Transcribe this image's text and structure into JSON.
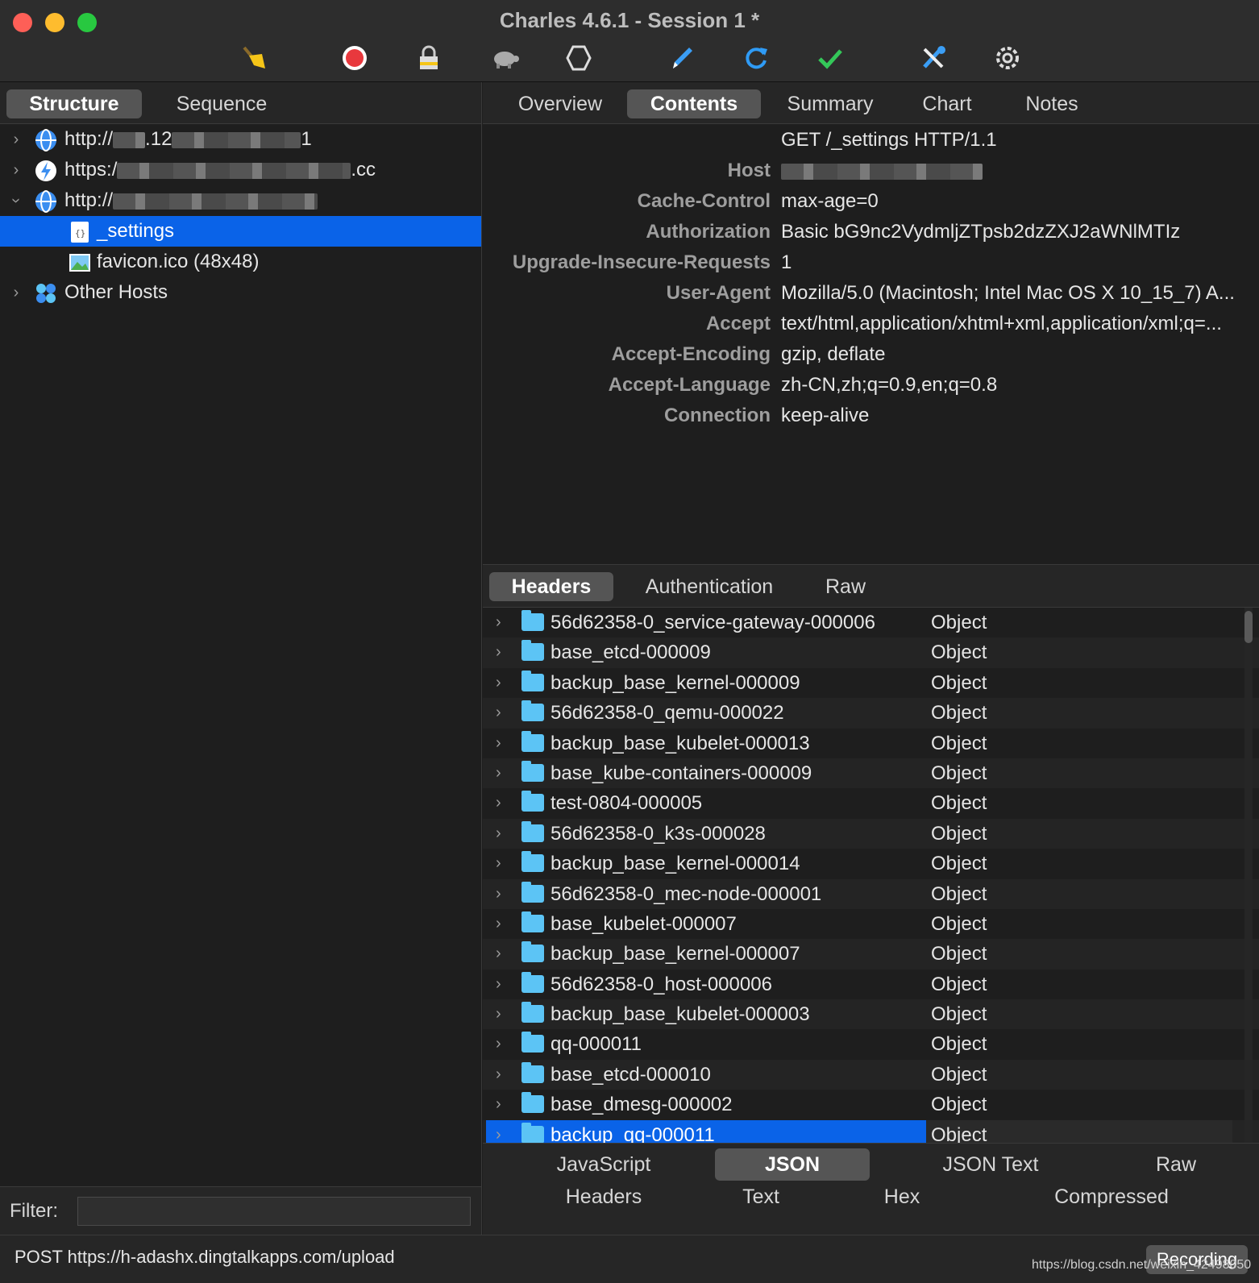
{
  "window": {
    "title": "Charles 4.6.1 - Session 1 *"
  },
  "toolbar": {
    "icons": [
      "broom-icon",
      "record-icon",
      "lock-icon",
      "turtle-icon",
      "hexagon-icon",
      "pen-icon",
      "refresh-icon",
      "check-icon",
      "tools-icon",
      "settings-icon"
    ],
    "colors": {
      "broom": "#f5c518",
      "record": "#e8383d",
      "refresh": "#2f9bf5",
      "check": "#34c759",
      "pen": "#3b9ef5",
      "tools": "#3b9ef5"
    }
  },
  "left_tabs": {
    "structure": "Structure",
    "sequence": "Sequence"
  },
  "tree": {
    "host1_prefix": "http://",
    "host1_part1": ".12",
    "host1_part2": "1",
    "host2_prefix": "https:/",
    "host2_suffix": ".cc",
    "host3_prefix": "http://",
    "settings": "_settings",
    "favicon": "favicon.ico (48x48)",
    "other_hosts": "Other Hosts"
  },
  "filter": {
    "label": "Filter:",
    "value": ""
  },
  "right_tabs": {
    "overview": "Overview",
    "contents": "Contents",
    "summary": "Summary",
    "chart": "Chart",
    "notes": "Notes"
  },
  "request": {
    "line": "GET /_settings HTTP/1.1",
    "headers": [
      {
        "key": "Host",
        "value": ""
      },
      {
        "key": "Cache-Control",
        "value": "max-age=0"
      },
      {
        "key": "Authorization",
        "value": "Basic bG9nc2VydmljZTpsb2dzZXJ2aWNlMTIz"
      },
      {
        "key": "Upgrade-Insecure-Requests",
        "value": "1"
      },
      {
        "key": "User-Agent",
        "value": "Mozilla/5.0 (Macintosh; Intel Mac OS X 10_15_7) A..."
      },
      {
        "key": "Accept",
        "value": "text/html,application/xhtml+xml,application/xml;q=..."
      },
      {
        "key": "Accept-Encoding",
        "value": "gzip, deflate"
      },
      {
        "key": "Accept-Language",
        "value": "zh-CN,zh;q=0.9,en;q=0.8"
      },
      {
        "key": "Connection",
        "value": "keep-alive"
      }
    ]
  },
  "sub_tabs": {
    "headers": "Headers",
    "authentication": "Authentication",
    "raw": "Raw"
  },
  "json_rows": [
    {
      "name": "56d62358-0_service-gateway-000006",
      "type": "Object"
    },
    {
      "name": "base_etcd-000009",
      "type": "Object"
    },
    {
      "name": "backup_base_kernel-000009",
      "type": "Object"
    },
    {
      "name": "56d62358-0_qemu-000022",
      "type": "Object"
    },
    {
      "name": "backup_base_kubelet-000013",
      "type": "Object"
    },
    {
      "name": "base_kube-containers-000009",
      "type": "Object"
    },
    {
      "name": "test-0804-000005",
      "type": "Object"
    },
    {
      "name": "56d62358-0_k3s-000028",
      "type": "Object"
    },
    {
      "name": "backup_base_kernel-000014",
      "type": "Object"
    },
    {
      "name": "56d62358-0_mec-node-000001",
      "type": "Object"
    },
    {
      "name": "base_kubelet-000007",
      "type": "Object"
    },
    {
      "name": "backup_base_kernel-000007",
      "type": "Object"
    },
    {
      "name": "56d62358-0_host-000006",
      "type": "Object"
    },
    {
      "name": "backup_base_kubelet-000003",
      "type": "Object"
    },
    {
      "name": "qq-000011",
      "type": "Object"
    },
    {
      "name": "base_etcd-000010",
      "type": "Object"
    },
    {
      "name": "base_dmesg-000002",
      "type": "Object"
    },
    {
      "name": "backup_qq-000011",
      "type": "Object"
    }
  ],
  "view_tabs": {
    "javascript": "JavaScript",
    "json": "JSON",
    "json_text": "JSON Text",
    "raw": "Raw",
    "headers": "Headers",
    "text": "Text",
    "hex": "Hex",
    "compressed": "Compressed"
  },
  "status": {
    "text": "POST https://h-adashx.dingtalkapps.com/upload",
    "recording": "Recording",
    "watermark": "https://blog.csdn.net/weixin_42498050"
  }
}
